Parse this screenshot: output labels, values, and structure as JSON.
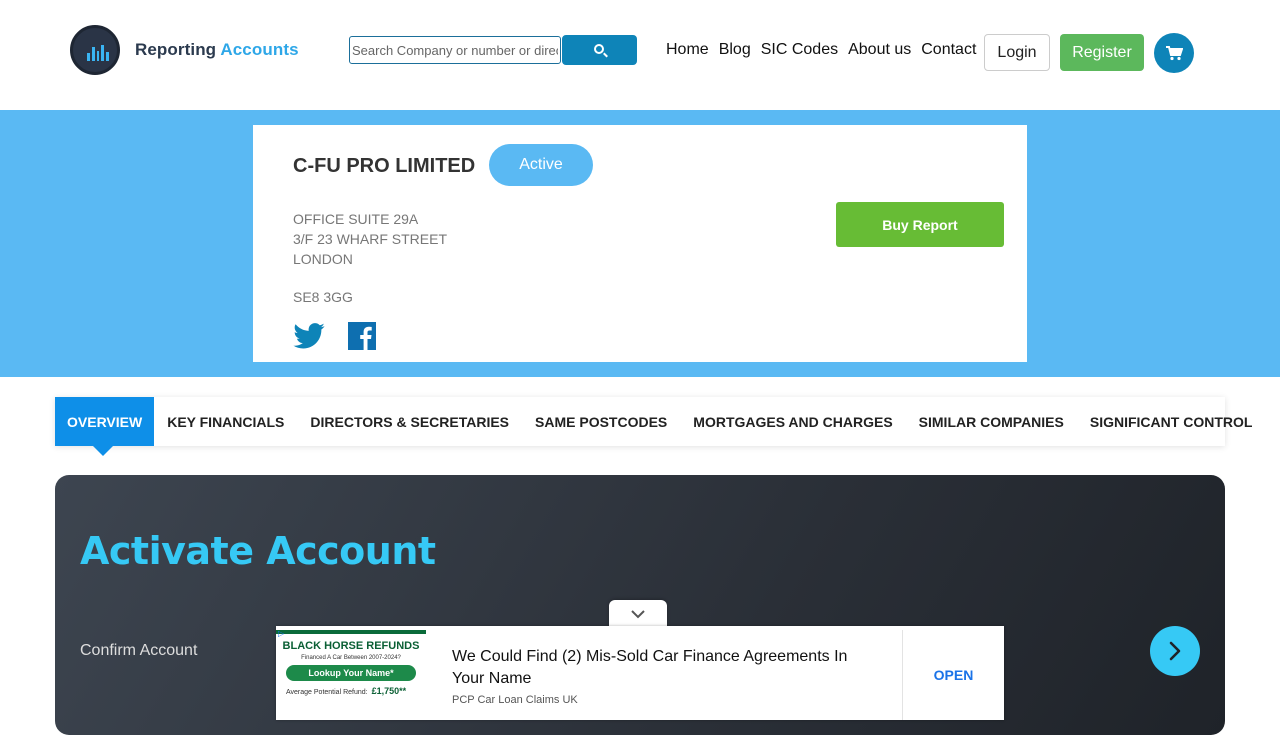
{
  "header": {
    "logo": {
      "text_main": "Reporting",
      "text_accent": "Accounts"
    },
    "search": {
      "placeholder": "Search Company or number or director"
    },
    "nav": [
      "Home",
      "Blog",
      "SIC Codes",
      "About us",
      "Contact"
    ],
    "login_label": "Login",
    "register_label": "Register"
  },
  "company": {
    "name": "C-FU PRO LIMITED",
    "status": "Active",
    "address": [
      "OFFICE SUITE 29A",
      "3/F 23 WHARF STREET",
      "LONDON"
    ],
    "postcode": "SE8 3GG",
    "buy_label": "Buy Report"
  },
  "tabs": [
    "OVERVIEW",
    "KEY FINANCIALS",
    "DIRECTORS & SECRETARIES",
    "SAME POSTCODES",
    "MORTGAGES AND CHARGES",
    "SIMILAR COMPANIES",
    "SIGNIFICANT CONTROL"
  ],
  "activate": {
    "title": "Activate Account",
    "step_label": "Confirm Account"
  },
  "ad": {
    "image_title": "BLACK HORSE REFUNDS",
    "image_sub": "Financed A Car Between 2007-2024?",
    "image_button": "Lookup Your Name*",
    "image_refund_label": "Average Potential Refund:",
    "image_refund_value": "£1,750**",
    "headline": "We Could Find (2) Mis-Sold Car Finance Agreements In Your Name",
    "source": "PCP Car Loan Claims UK",
    "cta": "OPEN"
  },
  "colors": {
    "brand_blue": "#0e84b8",
    "hero_bg": "#5ab9f3",
    "register_green": "#5cb85c",
    "buy_green": "#67bc35",
    "activate_accent": "#36c9f5",
    "tab_active": "#0e8fe8"
  }
}
